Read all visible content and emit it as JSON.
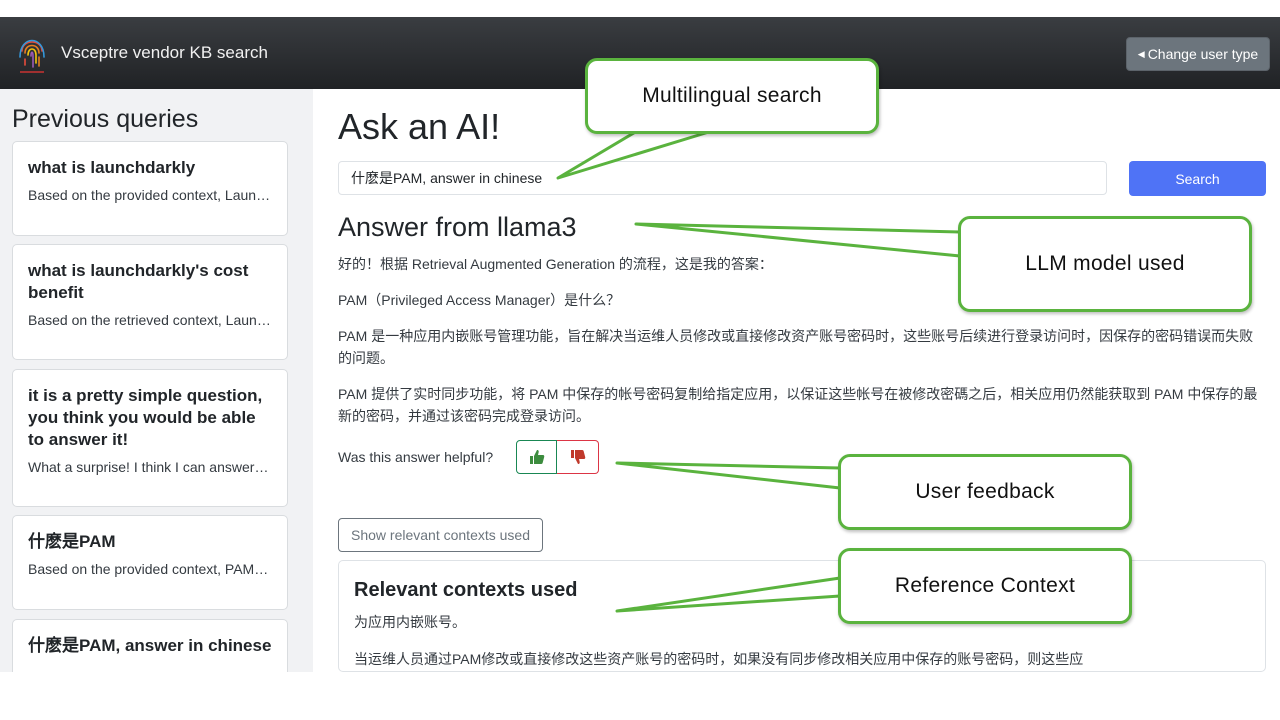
{
  "app": {
    "brand": "Vsceptre vendor KB search",
    "change_user_label": "Change user type"
  },
  "sidebar": {
    "title": "Previous queries",
    "items": [
      {
        "question": "what is launchdarkly",
        "answer": "Based on the provided context, LaunchDarkly is a feature management platform"
      },
      {
        "question": "what is launchdarkly's cost benefit",
        "answer": "Based on the retrieved context, LaunchDarkly offers several cost benefits"
      },
      {
        "question": "it is a pretty simple question, you think you would be able to answer it!",
        "answer": "What a surprise! I think I can answer that question"
      },
      {
        "question": "什麽是PAM",
        "answer": "Based on the provided context, PAM stands for Privileged Access Manager"
      },
      {
        "question": "什麽是PAM, answer in chinese",
        "answer": ""
      }
    ]
  },
  "main": {
    "title": "Ask an AI!",
    "search_value": "什麽是PAM, answer in chinese",
    "search_button": "Search",
    "answer_title": "Answer from llama3",
    "answer_paragraphs": [
      "好的！根据 Retrieval Augmented Generation 的流程，这是我的答案：",
      "PAM（Privileged Access Manager）是什么？",
      "PAM 是一种应用内嵌账号管理功能，旨在解决当运维人员修改或直接修改资产账号密码时，这些账号后续进行登录访问时，因保存的密码错误而失败的问题。",
      "PAM 提供了实时同步功能，将 PAM 中保存的帐号密码复制给指定应用，以保证这些帐号在被修改密碼之后，相关应用仍然能获取到 PAM 中保存的最新的密码，并通过该密码完成登录访问。"
    ],
    "helpful_label": "Was this answer helpful?",
    "show_contexts_label": "Show relevant contexts used",
    "contexts_title": "Relevant contexts used",
    "contexts_lines": [
      "为应用内嵌账号。",
      "当运维人员通过PAM修改或直接修改这些资产账号的密码时，如果没有同步修改相关应用中保存的账号密码，则这些应"
    ]
  },
  "annotations": {
    "multilingual": "Multilingual search",
    "llm_model": "LLM model used",
    "user_feedback": "User feedback",
    "reference_context": "Reference Context"
  },
  "colors": {
    "navbar": "#2b2d30",
    "primary_button": "#4f73f6",
    "callout_border": "#5ab33e",
    "thumbs_up": "#3c8c3e",
    "thumbs_down": "#c0392b"
  }
}
